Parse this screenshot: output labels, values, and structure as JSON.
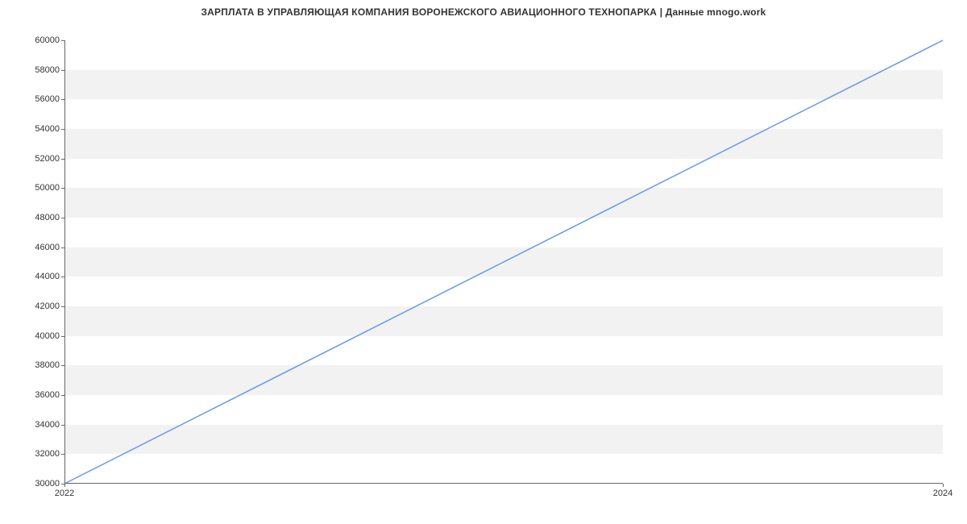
{
  "chart_data": {
    "type": "line",
    "title": "ЗАРПЛАТА В УПРАВЛЯЮЩАЯ КОМПАНИЯ ВОРОНЕЖСКОГО АВИАЦИОННОГО ТЕХНОПАРКА | Данные mnogo.work",
    "xlabel": "",
    "ylabel": "",
    "x_ticks": [
      2022,
      2024
    ],
    "y_ticks": [
      30000,
      32000,
      34000,
      36000,
      38000,
      40000,
      42000,
      44000,
      46000,
      48000,
      50000,
      52000,
      54000,
      56000,
      58000,
      60000
    ],
    "xlim": [
      2022,
      2024
    ],
    "ylim": [
      30000,
      60000
    ],
    "series": [
      {
        "name": "salary",
        "x": [
          2022,
          2024
        ],
        "y": [
          30000,
          60000
        ],
        "color": "#6699e6"
      }
    ],
    "grid": true
  }
}
